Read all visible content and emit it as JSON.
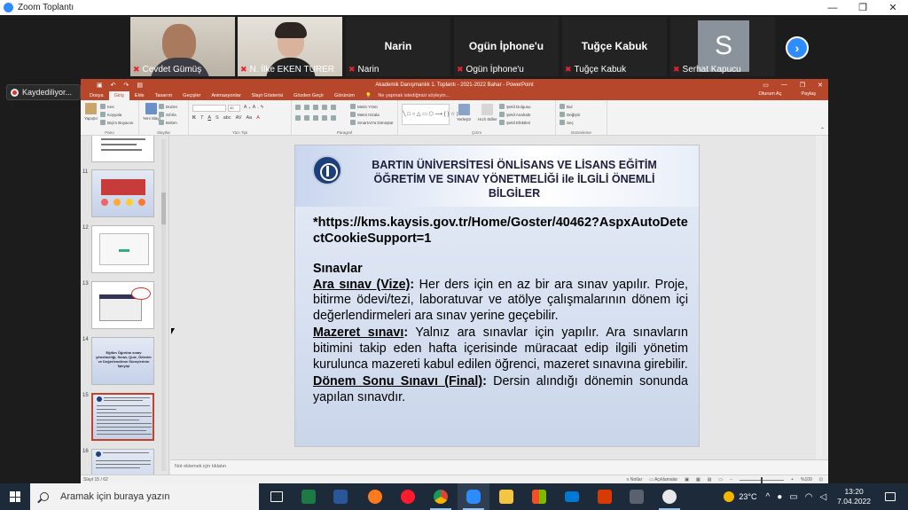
{
  "zoom": {
    "window_title": "Zoom Toplantı",
    "win_min": "—",
    "win_max": "❐",
    "win_close": "✕",
    "recording_label": "Kaydediliyor...",
    "next_arrow": "›"
  },
  "participants": [
    {
      "name": "Cevdet Gümüş",
      "type": "video"
    },
    {
      "name": "N. İlke EKEN TURER",
      "type": "video",
      "active": true
    },
    {
      "name": "Narin",
      "type": "name"
    },
    {
      "name": "Ogün İphone'u",
      "type": "name"
    },
    {
      "name": "Tuğçe Kabuk",
      "type": "name"
    },
    {
      "name": "Serhat Kapucu",
      "type": "avatar",
      "initial": "S"
    }
  ],
  "powerpoint": {
    "doc_title": "Akademik Danışmanlık 1. Toplantı - 2021-2022 Bahar - PowerPoint",
    "tabs": [
      "Dosya",
      "Giriş",
      "Ekle",
      "Tasarım",
      "Geçişler",
      "Animasyonlar",
      "Slayt Gösterisi",
      "Gözden Geçir",
      "Görünüm"
    ],
    "active_tab": "Giriş",
    "tell_me": "Ne yapmak istediğinizi söyleyin...",
    "account": "Oturum Aç",
    "share": "Paylaş",
    "ribbon": {
      "paste": "Yapıştır",
      "cut": "Kes",
      "copy": "Kopyala",
      "format_painter": "Biçim Boyacısı",
      "clipboard_group": "Pano",
      "new_slide": "Yeni Slayt",
      "layout": "Düzen",
      "reset": "Sıfırla",
      "section": "Bölüm",
      "slides_group": "Slaytlar",
      "font_group": "Yazı Tipi",
      "font_size": "40",
      "text_direction": "Metin Yönü",
      "align_text": "Metni Hizala",
      "smartart": "SmartArt'a Dönüştür",
      "paragraph_group": "Paragraf",
      "arrange": "Yerleştir",
      "quick_styles": "Hızlı Stiller",
      "shape_fill": "Şekil Dolgusu",
      "shape_outline": "Şekil Anahattı",
      "shape_effects": "Şekil Efektleri",
      "drawing_group": "Çizim",
      "find": "Bul",
      "replace": "Değiştir",
      "select": "Seç",
      "editing_group": "Düzenleme"
    },
    "thumbnails": [
      {
        "num": "11"
      },
      {
        "num": "12"
      },
      {
        "num": "13"
      },
      {
        "num": "14",
        "text": "Eğitim Öğretim sınav yönetmeliği, Sınav, Quiz, Ödevler ve Değerlendirme Süreçlerinin İşleyişi"
      },
      {
        "num": "15",
        "selected": true
      },
      {
        "num": "16"
      }
    ],
    "notes_placeholder": "Not eklemek için tıklatın",
    "status_left": "Slayt 15 / 62",
    "status_notes": "Notlar",
    "status_comments": "Açıklamalar",
    "zoom_level": "%109"
  },
  "slide": {
    "title": "BARTIN ÜNİVERSİTESİ ÖNLİSANS VE LİSANS EĞİTİM ÖĞRETİM VE SINAV YÖNETMELİĞİ ile İLGİLİ ÖNEMLİ BİLGİLER",
    "url": "*https://kms.kaysis.gov.tr/Home/Goster/40462?AspxAutoDetectCookieSupport=1",
    "section_title": "Sınavlar",
    "items": [
      {
        "label": "Ara sınav (Vize)",
        "sep": ":",
        "text": " Her ders için en az bir ara sınav yapılır. Proje, bitirme ödevi/tezi, laboratuvar ve atölye çalışmalarının dönem içi değerlendirmeleri ara sınav yerine geçebilir."
      },
      {
        "label": "Mazeret sınavı",
        "sep": ":",
        "text": " Yalnız ara sınavlar için yapılır. Ara sınavların bitimini takip eden hafta içerisinde müracaat edip ilgili yönetim kurulunca mazereti kabul edilen öğrenci, mazeret sınavına girebilir."
      },
      {
        "label": "Dönem Sonu Sınavı (Final)",
        "sep": ":",
        "text": " Dersin alındığı dönemin sonunda yapılan sınavdır."
      }
    ]
  },
  "taskbar": {
    "search_placeholder": "Aramak için buraya yazın",
    "temperature": "23°C",
    "time": "13:20",
    "date": "7.04.2022",
    "tray_up": "^",
    "apps": [
      "task-view",
      "excel",
      "word",
      "firefox",
      "opera",
      "chrome",
      "zoom",
      "file-explorer",
      "store",
      "mail",
      "office",
      "calculator",
      "paint"
    ]
  },
  "colors": {
    "ppt_accent": "#b7472a",
    "zoom_blue": "#2d8cff",
    "taskbar": "#1d2a3a"
  }
}
